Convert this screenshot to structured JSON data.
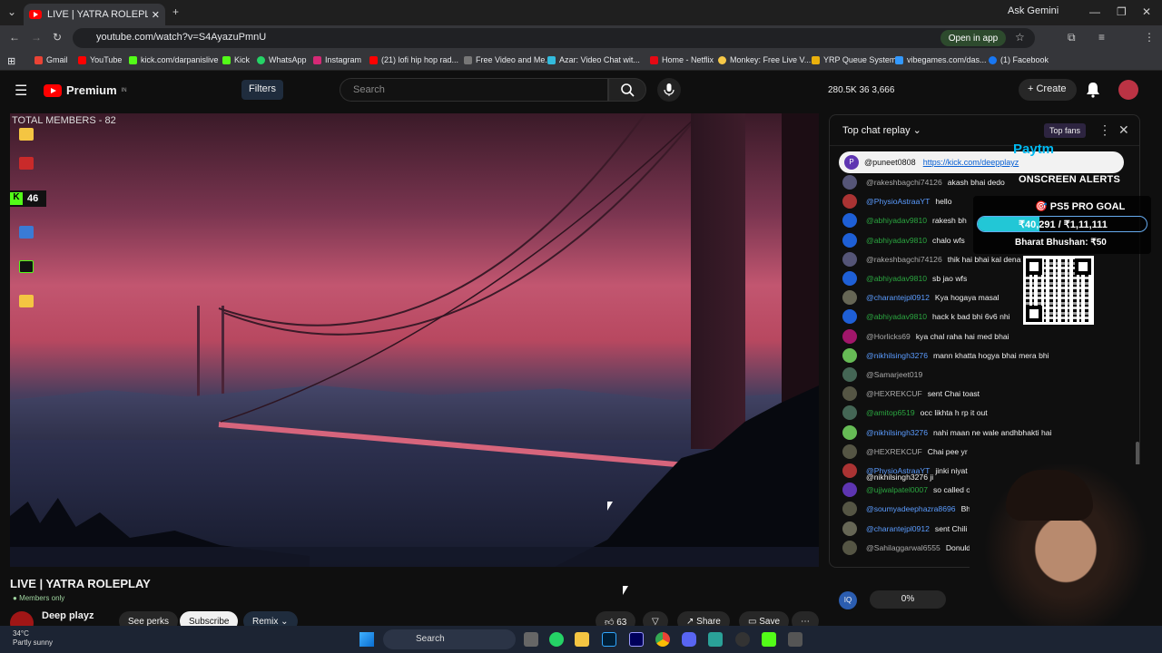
{
  "browser": {
    "tab_title": "LIVE | YATRA ROLEPLAY - Y",
    "url": "youtube.com/watch?v=S4AyazuPmnU",
    "open_app": "Open in app",
    "ask_gemini": "Ask Gemini",
    "bookmarks": [
      "Gmail",
      "YouTube",
      "kick.com/darpanislive",
      "Kick",
      "WhatsApp",
      "Instagram",
      "(21) lofi hip hop rad...",
      "Free Video and Me...",
      "Azar: Video Chat wit...",
      "Home - Netflix",
      "Monkey: Free Live V...",
      "YRP Queue System",
      "vibegames.com/das...",
      "(1) Facebook"
    ]
  },
  "header": {
    "logo": "Premium",
    "logo_sup": "IN",
    "filters": "Filters",
    "search_placeholder": "Search",
    "stats": "280.5K  36  3,666",
    "create": "Create"
  },
  "video": {
    "overlay_title": "TOTAL MEMBERS - 82",
    "kick_count": "46"
  },
  "below": {
    "title": "LIVE | YATRA ROLEPLAY",
    "members_only": "Members only",
    "channel": "Deep playz",
    "see_perks": "See perks",
    "subscribe": "Subscribe",
    "remix": "Remix",
    "likes": "63",
    "share": "Share",
    "save": "Save"
  },
  "chat": {
    "title": "Top chat replay",
    "top_fans": "Top fans",
    "pinned_user": "@puneet0808",
    "pinned_link": "https://kick.com/deepplayz",
    "messages": [
      {
        "author": "@rakeshbagchi74126",
        "text": "akash bhai dedo",
        "cls": "",
        "avc": "#557"
      },
      {
        "author": "@PhysioAstraaYT",
        "text": "hello",
        "cls": "blue",
        "avc": "#a33"
      },
      {
        "author": "@abhiyadav9810",
        "text": "rakesh bh",
        "cls": "mem",
        "avc": "#1e5fd6"
      },
      {
        "author": "@abhiyadav9810",
        "text": "chalo wfs",
        "cls": "mem",
        "avc": "#1e5fd6"
      },
      {
        "author": "@rakeshbagchi74126",
        "text": "thik hai bhai kal dena",
        "cls": "",
        "avc": "#557"
      },
      {
        "author": "@abhiyadav9810",
        "text": "sb jao wfs",
        "cls": "mem",
        "avc": "#1e5fd6"
      },
      {
        "author": "@charantejpl0912",
        "text": "Kya hogaya masal",
        "cls": "blue",
        "avc": "#665"
      },
      {
        "author": "@abhiyadav9810",
        "text": "hack k bad bhi 6v6 nhi",
        "cls": "mem",
        "avc": "#1e5fd6"
      },
      {
        "author": "@Horlicks69",
        "text": "kya chal raha hai med bhai",
        "cls": "",
        "avc": "#a1166a"
      },
      {
        "author": "@nikhilsingh3276",
        "text": "mann khatta hogya bhai mera bhi",
        "cls": "blue",
        "avc": "#6b5"
      },
      {
        "author": "@Samarjeet019",
        "text": "",
        "cls": "",
        "avc": "#465"
      },
      {
        "author": "@HEXREKCUF",
        "text": "sent Chai toast",
        "cls": "",
        "avc": "#554"
      },
      {
        "author": "@amitop6519",
        "text": "occ likhta h rp it out",
        "cls": "mem",
        "avc": "#465"
      },
      {
        "author": "@nikhilsingh3276",
        "text": "nahi maan ne wale andhbhakti hai",
        "cls": "blue",
        "avc": "#6b5"
      },
      {
        "author": "@HEXREKCUF",
        "text": "Chai pee yr",
        "cls": "",
        "avc": "#554"
      },
      {
        "author": "@PhysioAstraaYT",
        "text": "jinki niyat khatti h",
        "cls": "blue",
        "avc": "#a33"
      },
      {
        "author": "@ujjwalpatel0007",
        "text": "so called old",
        "cls": "mem",
        "avc": "#5e35b1"
      },
      {
        "author": "@soumyadeephazra8696",
        "text": "Bhai k",
        "cls": "blue",
        "avc": "#554"
      },
      {
        "author": "@charantejpl0912",
        "text": "sent Chili",
        "cls": "blue",
        "avc": "#665"
      },
      {
        "author": "@Sahilaggarwal6555",
        "text": "Donuld du",
        "cls": "",
        "avc": "#554"
      }
    ],
    "reply_snippet": "@nikhilsingh3276 ji",
    "progress": "0%"
  },
  "overlay": {
    "paytm": "Paytm",
    "onscreen": "ONSCREEN ALERTS",
    "goal_title": "PS5 PRO GOAL",
    "goal_amount": "₹40,291 / ₹1,11,111",
    "goal_fraction": 0.363,
    "goal_donor": "Bharat Bhushan: ₹50"
  },
  "taskbar": {
    "temp": "34°C",
    "weather": "Partly sunny",
    "search": "Search"
  }
}
